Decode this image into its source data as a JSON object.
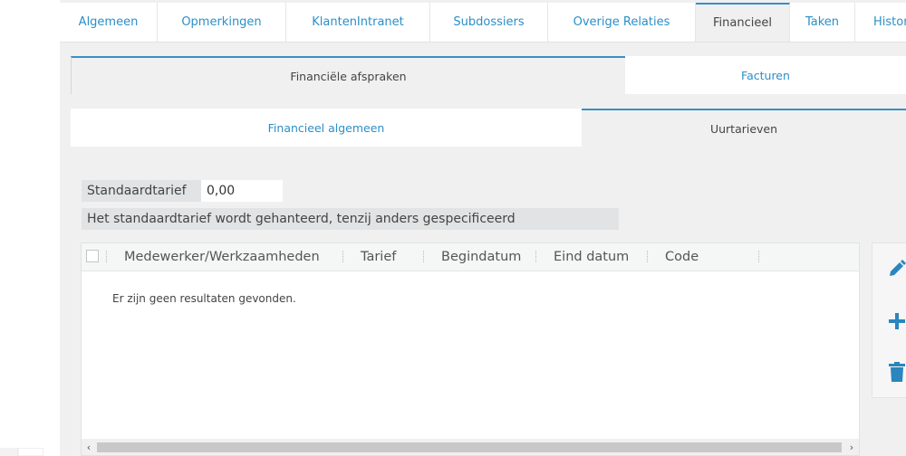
{
  "top_tabs": [
    {
      "label": "Algemeen",
      "active": false
    },
    {
      "label": "Opmerkingen",
      "active": false
    },
    {
      "label": "KlantenIntranet",
      "active": false
    },
    {
      "label": "Subdossiers",
      "active": false
    },
    {
      "label": "Overige Relaties",
      "active": false
    },
    {
      "label": "Financieel",
      "active": true
    },
    {
      "label": "Taken",
      "active": false
    },
    {
      "label": "Histori",
      "active": false
    }
  ],
  "sub_tabs_1": [
    {
      "label": "Financiële afspraken",
      "active": true
    },
    {
      "label": "Facturen",
      "active": false
    }
  ],
  "sub_tabs_2": [
    {
      "label": "Financieel algemeen",
      "active": false
    },
    {
      "label": "Uurtarieven",
      "active": true
    }
  ],
  "standaardtarief": {
    "label": "Standaardtarief",
    "value": "0,00",
    "hint": "Het standaardtarief wordt gehanteerd, tenzij anders gespecificeerd"
  },
  "grid": {
    "columns": [
      "Medewerker/Werkzaamheden",
      "Tarief",
      "Begindatum",
      "Eind datum",
      "Code"
    ],
    "empty_message": "Er zijn geen resultaten gevonden.",
    "scroll_left": "‹",
    "scroll_right": "›"
  },
  "actions": [
    {
      "icon": "pencil-icon",
      "name": "edit-button"
    },
    {
      "icon": "plus-icon",
      "name": "add-button"
    },
    {
      "icon": "trash-icon",
      "name": "delete-button"
    }
  ],
  "colors": {
    "accent": "#2b8fc7",
    "active_border": "#3a8fc4",
    "icon": "#2a86bd"
  }
}
